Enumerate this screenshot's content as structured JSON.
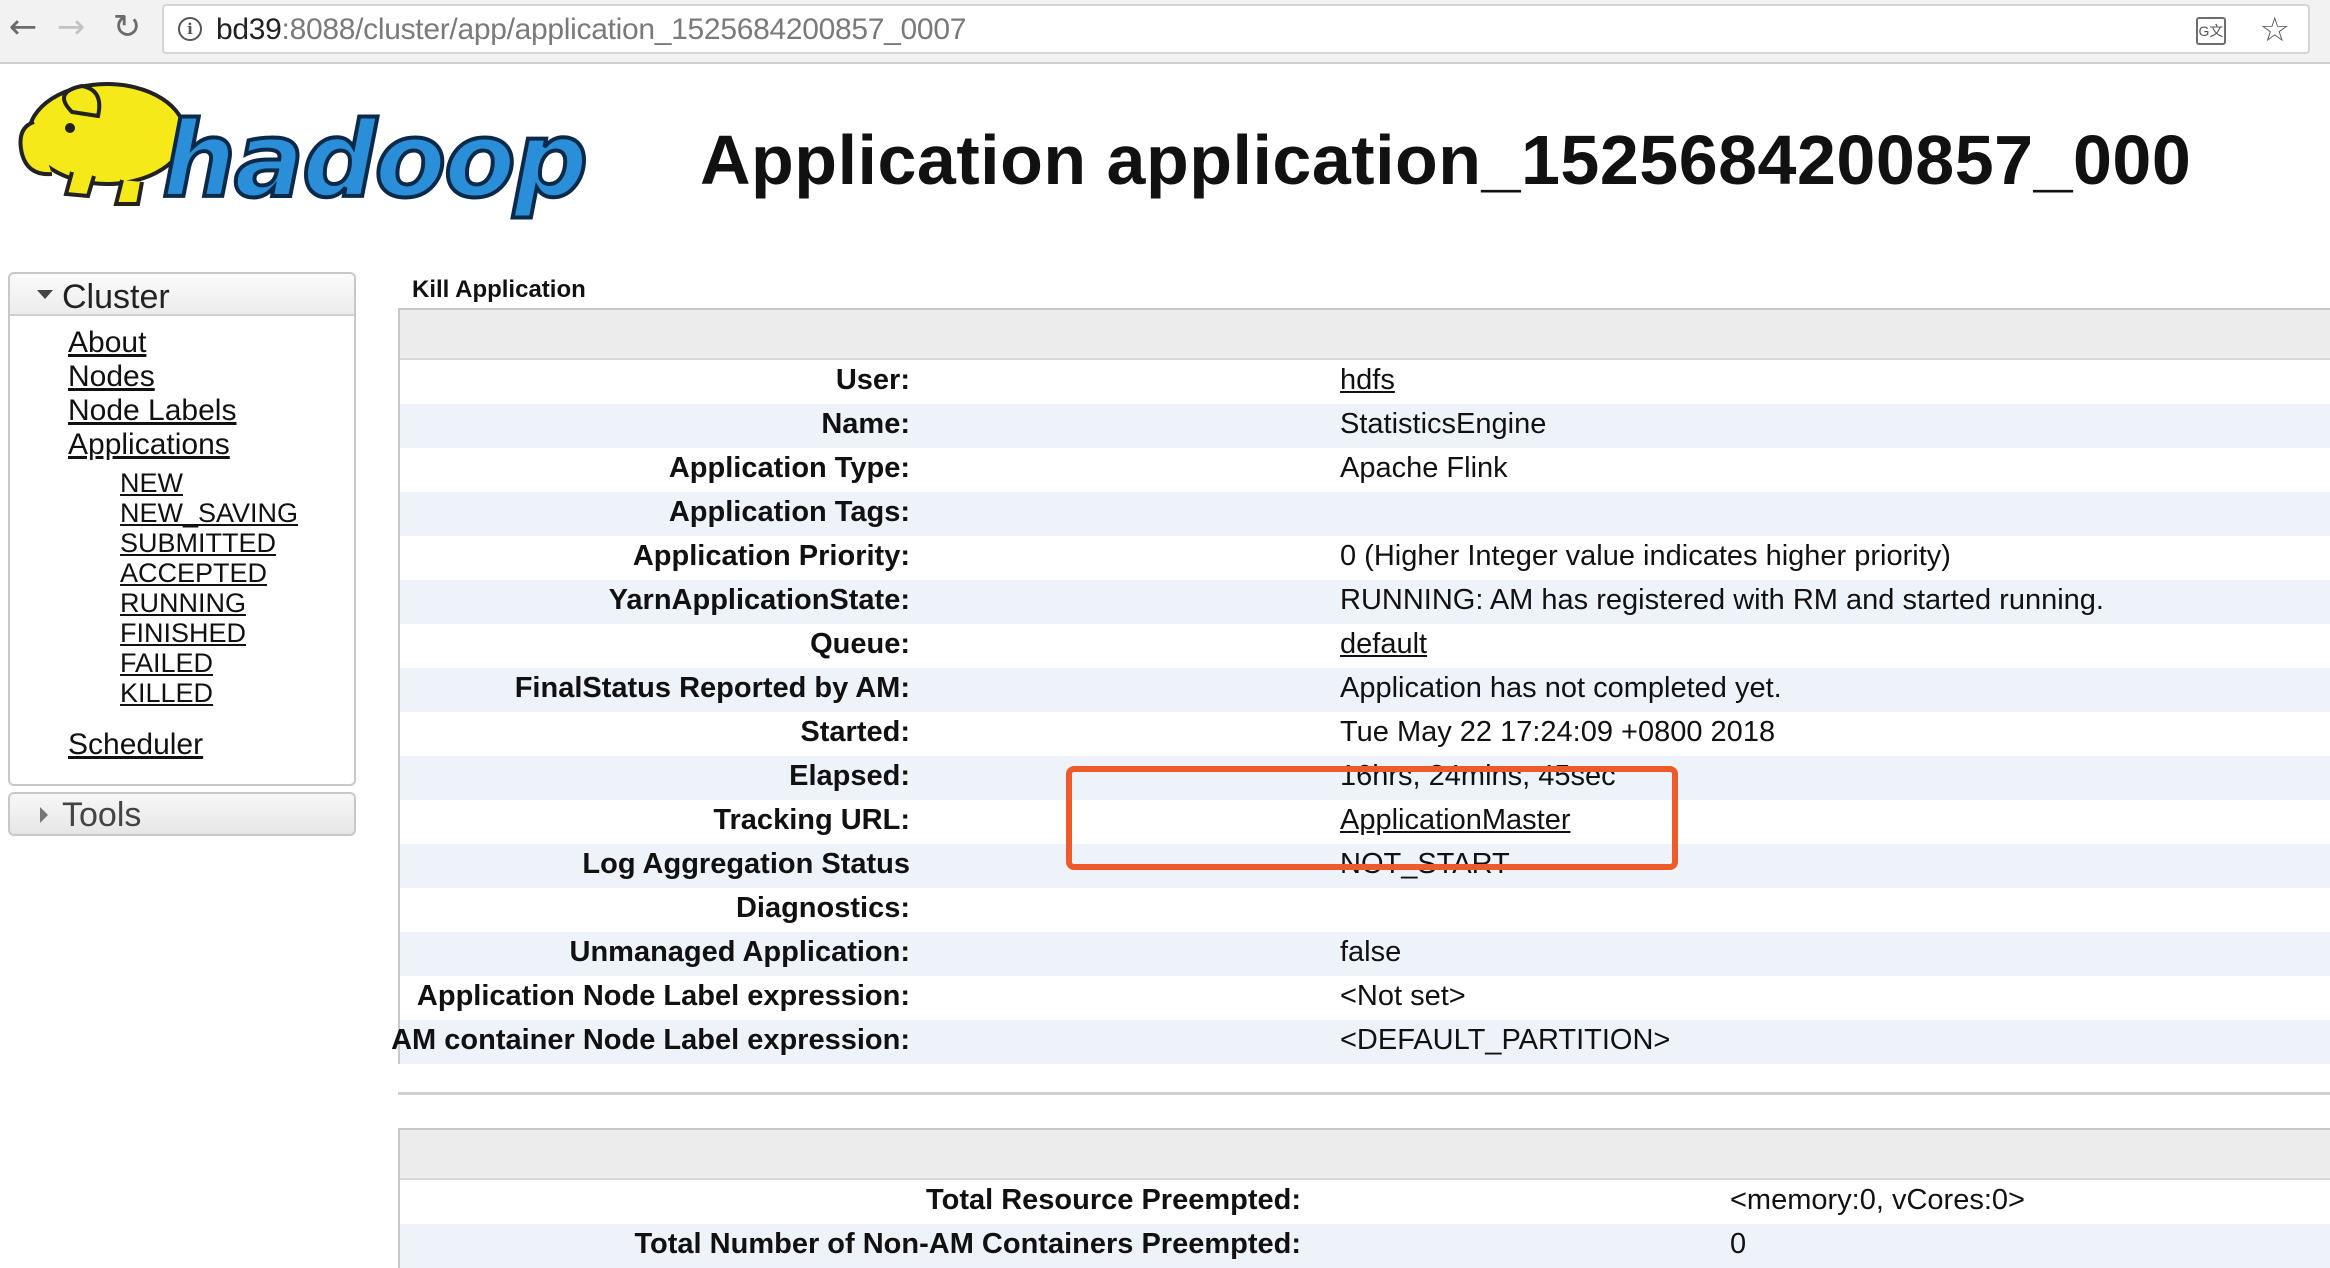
{
  "browser": {
    "url_host": "bd39",
    "url_rest": ":8088/cluster/app/application_1525684200857_0007",
    "back_icon": "back-arrow-icon",
    "forward_icon": "forward-arrow-icon",
    "reload_icon": "reload-icon"
  },
  "header": {
    "logo_text": "hadoop",
    "title": "Application application_1525684200857_000"
  },
  "sidebar": {
    "cluster_label": "Cluster",
    "links": [
      "About",
      "Nodes",
      "Node Labels",
      "Applications"
    ],
    "app_states": [
      "NEW",
      "NEW_SAVING",
      "SUBMITTED",
      "ACCEPTED",
      "RUNNING",
      "FINISHED",
      "FAILED",
      "KILLED"
    ],
    "scheduler": "Scheduler",
    "tools_label": "Tools"
  },
  "main": {
    "kill_label": "Kill Application",
    "overview": [
      {
        "key": "User:",
        "value": "hdfs",
        "link": true
      },
      {
        "key": "Name:",
        "value": "StatisticsEngine"
      },
      {
        "key": "Application Type:",
        "value": "Apache Flink"
      },
      {
        "key": "Application Tags:",
        "value": ""
      },
      {
        "key": "Application Priority:",
        "value": "0 (Higher Integer value indicates higher priority)"
      },
      {
        "key": "YarnApplicationState:",
        "value": "RUNNING: AM has registered with RM and started running."
      },
      {
        "key": "Queue:",
        "value": "default",
        "link": true
      },
      {
        "key": "FinalStatus Reported by AM:",
        "value": "Application has not completed yet."
      },
      {
        "key": "Started:",
        "value": "Tue May 22 17:24:09 +0800 2018"
      },
      {
        "key": "Elapsed:",
        "value": "16hrs, 24mins, 45sec"
      },
      {
        "key": "Tracking URL:",
        "value": "ApplicationMaster",
        "link": true
      },
      {
        "key": "Log Aggregation Status",
        "value": "NOT_START"
      },
      {
        "key": "Diagnostics:",
        "value": ""
      },
      {
        "key": "Unmanaged Application:",
        "value": "false"
      },
      {
        "key": "Application Node Label expression:",
        "value": "<Not set>"
      },
      {
        "key": "AM container Node Label expression:",
        "value": "<DEFAULT_PARTITION>"
      }
    ],
    "preemption": [
      {
        "key": "Total Resource Preempted:",
        "value": "<memory:0, vCores:0>"
      },
      {
        "key": "Total Number of Non-AM Containers Preempted:",
        "value": "0"
      }
    ]
  }
}
